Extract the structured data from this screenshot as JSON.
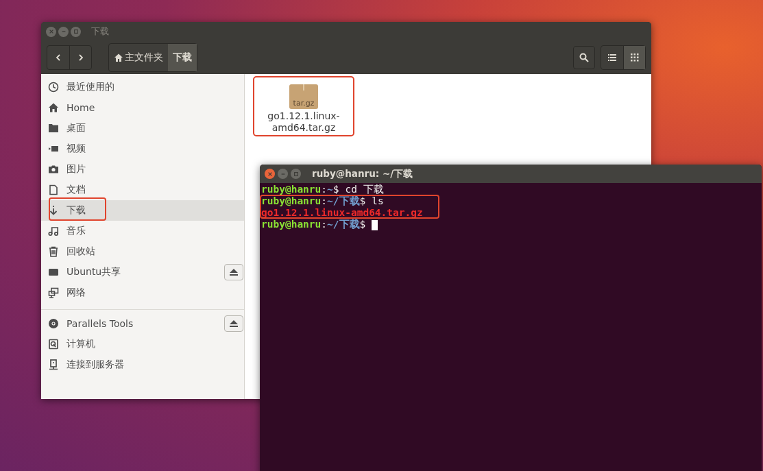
{
  "file_manager": {
    "title": "下载",
    "breadcrumbs": [
      {
        "label": "主文件夹",
        "selected": false,
        "home": true
      },
      {
        "label": "下载",
        "selected": true,
        "home": false
      }
    ],
    "views": [
      {
        "kind": "list",
        "selected": false
      },
      {
        "kind": "grid",
        "selected": true
      }
    ],
    "sidebar": {
      "groups": [
        {
          "items": [
            {
              "label": "最近使用的",
              "selected": false,
              "highlighted": false,
              "eject": false
            },
            {
              "label": "Home",
              "selected": false,
              "highlighted": false,
              "eject": false
            },
            {
              "label": "桌面",
              "selected": false,
              "highlighted": false,
              "eject": false
            },
            {
              "label": "视频",
              "selected": false,
              "highlighted": false,
              "eject": false
            },
            {
              "label": "图片",
              "selected": false,
              "highlighted": false,
              "eject": false
            },
            {
              "label": "文档",
              "selected": false,
              "highlighted": false,
              "eject": false
            },
            {
              "label": "下载",
              "selected": true,
              "highlighted": true,
              "eject": false
            },
            {
              "label": "音乐",
              "selected": false,
              "highlighted": false,
              "eject": false
            },
            {
              "label": "回收站",
              "selected": false,
              "highlighted": false,
              "eject": false
            },
            {
              "label": "Ubuntu共享",
              "selected": false,
              "highlighted": false,
              "eject": true
            },
            {
              "label": "网络",
              "selected": false,
              "highlighted": false,
              "eject": false
            }
          ]
        },
        {
          "items": [
            {
              "label": "Parallels Tools",
              "selected": false,
              "highlighted": false,
              "eject": true
            },
            {
              "label": "计算机",
              "selected": false,
              "highlighted": false,
              "eject": false
            },
            {
              "label": "连接到服务器",
              "selected": false,
              "highlighted": false,
              "eject": false
            }
          ]
        }
      ]
    },
    "files": [
      {
        "name": "go1.12.1.linux-amd64.tar.gz",
        "type_label": "tar.gz",
        "highlighted": true
      }
    ]
  },
  "terminal": {
    "title": "ruby@hanru: ~/下载",
    "blocks": [
      {
        "highlighted": false,
        "lines": [
          {
            "cursor": false,
            "parts": [
              {
                "kind": "user",
                "text": "ruby@hanru"
              },
              {
                "kind": "sep",
                "text": ":"
              },
              {
                "kind": "path",
                "text": "~"
              },
              {
                "kind": "sep",
                "text": "$"
              },
              {
                "kind": "command",
                "text": "cd 下载"
              }
            ]
          }
        ]
      },
      {
        "highlighted": true,
        "lines": [
          {
            "cursor": false,
            "parts": [
              {
                "kind": "user",
                "text": "ruby@hanru"
              },
              {
                "kind": "sep",
                "text": ":"
              },
              {
                "kind": "path",
                "text": "~/下载"
              },
              {
                "kind": "sep",
                "text": "$"
              },
              {
                "kind": "command",
                "text": "ls"
              }
            ]
          },
          {
            "cursor": false,
            "parts": [
              {
                "kind": "archive",
                "text": "go1.12.1.linux-amd64.tar.gz"
              }
            ]
          }
        ]
      },
      {
        "highlighted": false,
        "lines": [
          {
            "cursor": true,
            "parts": [
              {
                "kind": "user",
                "text": "ruby@hanru"
              },
              {
                "kind": "sep",
                "text": ":"
              },
              {
                "kind": "path",
                "text": "~/下载"
              },
              {
                "kind": "sep",
                "text": "$"
              }
            ]
          }
        ]
      }
    ]
  }
}
